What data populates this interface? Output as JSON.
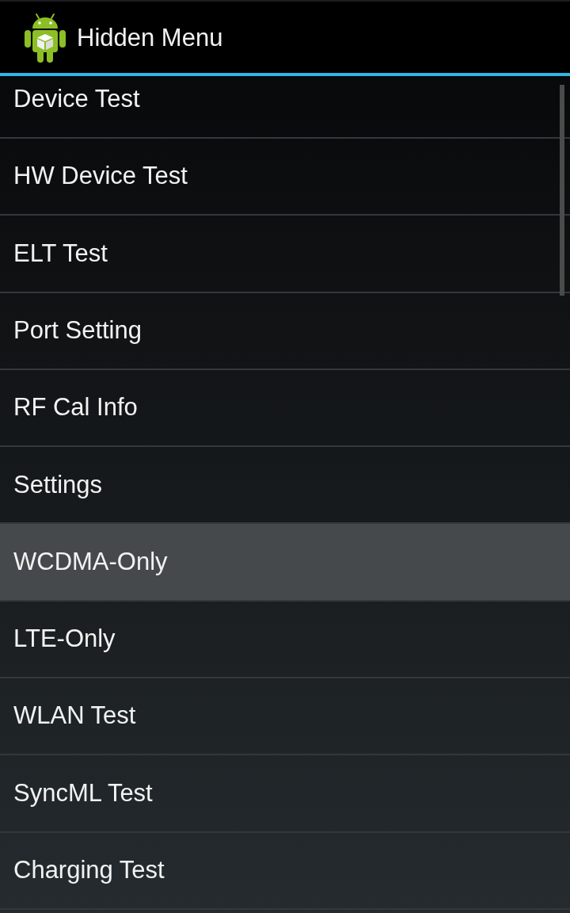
{
  "action_bar": {
    "title": "Hidden Menu"
  },
  "menu_items": [
    {
      "label": "Device Test",
      "selected": false
    },
    {
      "label": "HW Device Test",
      "selected": false
    },
    {
      "label": "ELT Test",
      "selected": false
    },
    {
      "label": "Port Setting",
      "selected": false
    },
    {
      "label": "RF Cal Info",
      "selected": false
    },
    {
      "label": "Settings",
      "selected": false
    },
    {
      "label": "WCDMA-Only",
      "selected": true
    },
    {
      "label": "LTE-Only",
      "selected": false
    },
    {
      "label": "WLAN Test",
      "selected": false
    },
    {
      "label": "SyncML Test",
      "selected": false
    },
    {
      "label": "Charging Test",
      "selected": false
    }
  ]
}
